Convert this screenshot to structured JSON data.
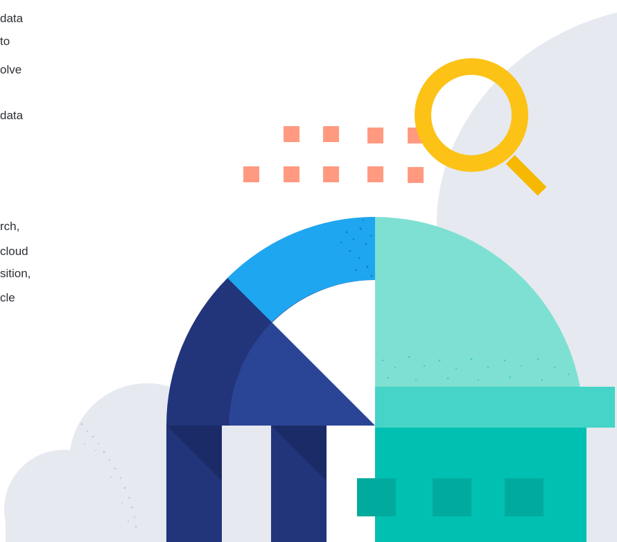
{
  "intro_text": {
    "paragraph_1": [
      "data",
      "to",
      "olve",
      "",
      "data"
    ],
    "paragraph_2": [
      "rch,",
      "cloud",
      "sition,",
      "cle"
    ]
  },
  "illustration": {
    "elements": [
      "decorative-cloud",
      "magnifying-glass-icon",
      "salmon-dot-grid",
      "dome-building",
      "server-rack"
    ],
    "colors": {
      "cloud": "#e6e9f0",
      "magnifier": "#fcc216",
      "dots": "#ff9a80",
      "arc_blue": "#1fa6f1",
      "navy": "#22357b",
      "navy_mid": "#2a4595",
      "navy_dark": "#1a2b68",
      "teal_light": "#7ee0d2",
      "teal": "#45d4c7",
      "teal_base": "#00c0b1",
      "teal_dark": "#00ab9d"
    }
  }
}
